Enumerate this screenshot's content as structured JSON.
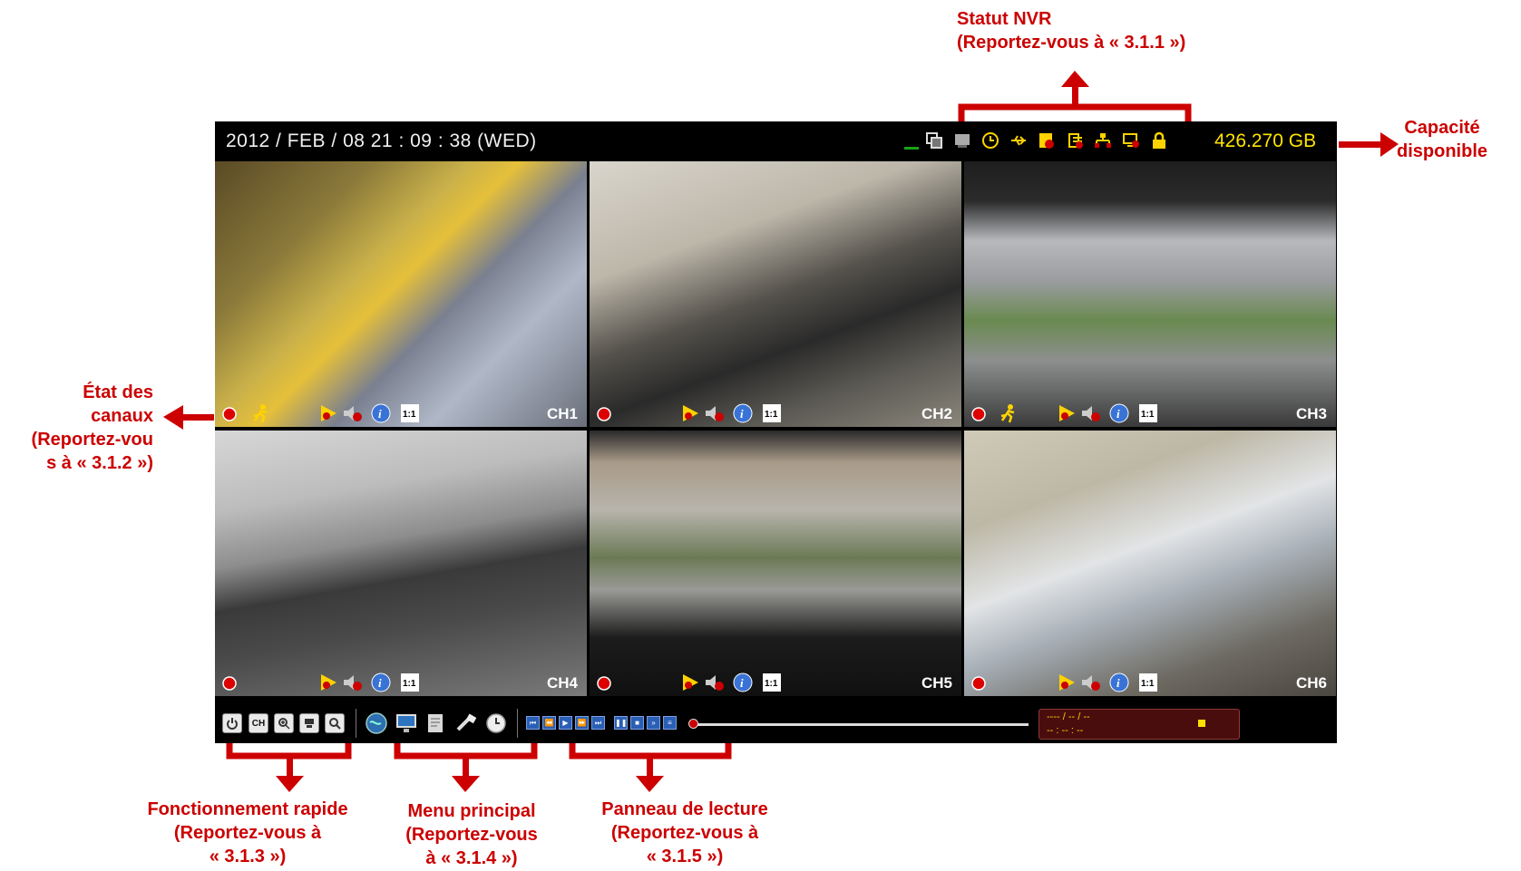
{
  "top_bar": {
    "datetime": "2012 / FEB / 08  21 : 09 : 38 (WED)",
    "capacity": "426.270 GB",
    "status_icons": [
      "window-icon",
      "hdd-icon",
      "clock-icon",
      "usb-icon",
      "record-icon",
      "network-icon",
      "lan-icon",
      "backup-icon",
      "lock-icon"
    ]
  },
  "channels": [
    {
      "label": "CH1",
      "icons": [
        "record-dot-icon",
        "motion-icon",
        "playback-icon",
        "audio-icon",
        "info-icon",
        "ratio-icon"
      ]
    },
    {
      "label": "CH2",
      "icons": [
        "record-dot-icon",
        "playback-icon",
        "audio-icon",
        "info-icon",
        "ratio-icon"
      ]
    },
    {
      "label": "CH3",
      "icons": [
        "record-dot-icon",
        "motion-icon",
        "playback-icon",
        "audio-icon",
        "info-icon",
        "ratio-icon"
      ]
    },
    {
      "label": "CH4",
      "icons": [
        "record-dot-icon",
        "playback-icon",
        "audio-icon",
        "info-icon",
        "ratio-icon"
      ]
    },
    {
      "label": "CH5",
      "icons": [
        "record-dot-icon",
        "playback-icon",
        "audio-icon",
        "info-icon",
        "ratio-icon"
      ]
    },
    {
      "label": "CH6",
      "icons": [
        "record-dot-icon",
        "playback-icon",
        "audio-icon",
        "info-icon",
        "ratio-icon"
      ]
    }
  ],
  "quick_buttons": [
    "power-icon",
    "CH",
    "zoom-icon",
    "camera-icon",
    "search-icon"
  ],
  "playback_box": {
    "date": "---- / -- / --",
    "time": "-- : -- : --"
  },
  "annotations": {
    "nvr_status": [
      "Statut NVR",
      "(Reportez-vous à « 3.1.1 »)"
    ],
    "capacity": [
      "Capacité",
      "disponible"
    ],
    "channel_state": [
      "État des",
      "canaux",
      "(Reportez-vou",
      "s à « 3.1.2 »)"
    ],
    "quick_op": [
      "Fonctionnement rapide",
      "(Reportez-vous à",
      "« 3.1.3 »)"
    ],
    "main_menu": [
      "Menu principal",
      "(Reportez-vous",
      "à « 3.1.4 »)"
    ],
    "playback_panel": [
      "Panneau de lecture",
      "(Reportez-vous à",
      "« 3.1.5 »)"
    ]
  },
  "colors": {
    "annotation": "#cc0000",
    "capacity": "#ffe400",
    "bar": "#000000"
  }
}
